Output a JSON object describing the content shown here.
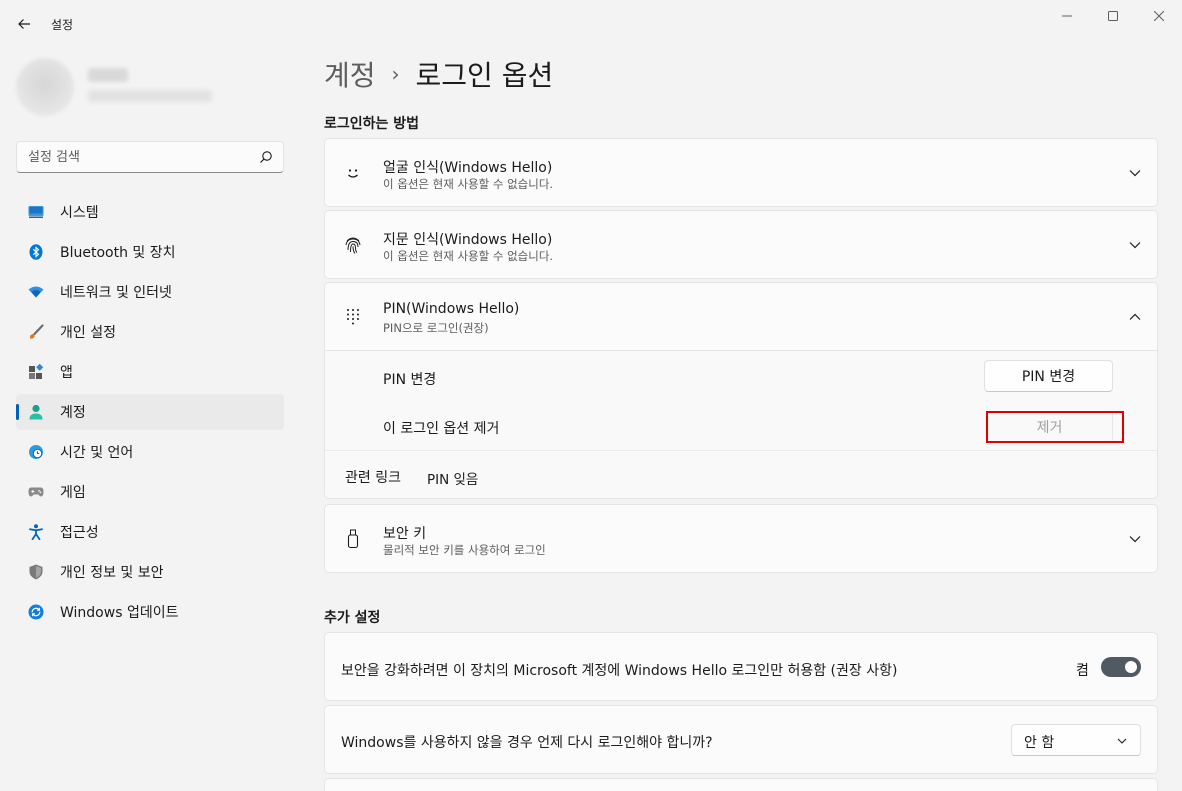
{
  "window": {
    "title": "설정",
    "minimize_glyph": "—",
    "maximize_glyph": "☐",
    "close_glyph": "✕"
  },
  "search": {
    "placeholder": "설정 검색"
  },
  "sidebar": {
    "items": [
      {
        "label": "시스템",
        "icon": "monitor-icon",
        "color": "#0067c0"
      },
      {
        "label": "Bluetooth 및 장치",
        "icon": "bluetooth-icon",
        "color": "#0078d4"
      },
      {
        "label": "네트워크 및 인터넷",
        "icon": "wifi-icon",
        "color": "#1a7fd4"
      },
      {
        "label": "개인 설정",
        "icon": "brush-icon",
        "color": "#e4731a"
      },
      {
        "label": "앱",
        "icon": "apps-icon",
        "color": "#555555"
      },
      {
        "label": "계정",
        "icon": "person-icon",
        "color": "#1f9e8a"
      },
      {
        "label": "시간 및 언어",
        "icon": "globe-clock-icon",
        "color": "#0f7cc9"
      },
      {
        "label": "게임",
        "icon": "gamepad-icon",
        "color": "#6b6b6b"
      },
      {
        "label": "접근성",
        "icon": "accessibility-icon",
        "color": "#0067c0"
      },
      {
        "label": "개인 정보 및 보안",
        "icon": "shield-icon",
        "color": "#6e6e6e"
      },
      {
        "label": "Windows 업데이트",
        "icon": "update-icon",
        "color": "#0078d4"
      }
    ],
    "active_index": 5
  },
  "main": {
    "breadcrumb": {
      "parent": "계정",
      "separator": "›",
      "current": "로그인 옵션"
    },
    "section_signin": "로그인하는 방법",
    "face": {
      "title": "얼굴 인식(Windows Hello)",
      "subtitle": "이 옵션은 현재 사용할 수 없습니다."
    },
    "fingerprint": {
      "title": "지문 인식(Windows Hello)",
      "subtitle": "이 옵션은 현재 사용할 수 없습니다."
    },
    "pin": {
      "title": "PIN(Windows Hello)",
      "subtitle": "PIN으로 로그인(권장)",
      "change_label": "PIN 변경",
      "change_button": "PIN 변경",
      "remove_label": "이 로그인 옵션 제거",
      "remove_button": "제거",
      "related_label": "관련 링크",
      "related_link": "PIN 잊음"
    },
    "security_key": {
      "title": "보안 키",
      "subtitle": "물리적 보안 키를 사용하여 로그인"
    },
    "section_additional": "추가 설정",
    "hello_only": {
      "label": "보안을 강화하려면 이 장치의 Microsoft 계정에 Windows Hello 로그인만 허용함 (권장 사항)",
      "state": "켬"
    },
    "require_signin": {
      "label": "Windows를 사용하지 않을 경우 언제 다시 로그인해야 합니까?",
      "value": "안 함"
    }
  },
  "colors": {
    "accent": "#005fb8",
    "highlight": "#e00000",
    "toggle_on": "#4f5a63"
  }
}
